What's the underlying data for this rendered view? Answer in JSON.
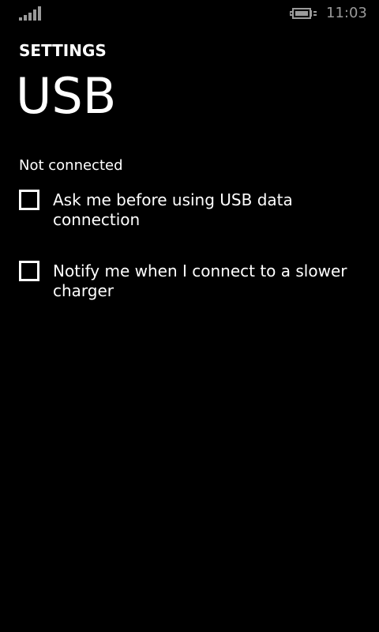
{
  "status_bar": {
    "time": "11:03",
    "signal_icon": "signal-strength-icon",
    "battery_icon": "battery-charging-icon"
  },
  "header": {
    "app_title": "SETTINGS",
    "page_title": "USB"
  },
  "connection_status": "Not connected",
  "options": [
    {
      "label": "Ask me before using USB data connection",
      "checked": false
    },
    {
      "label": "Notify me when I connect to a slower charger",
      "checked": false
    }
  ],
  "colors": {
    "background": "#000000",
    "foreground": "#ffffff",
    "clock": "#9a9a9a"
  }
}
